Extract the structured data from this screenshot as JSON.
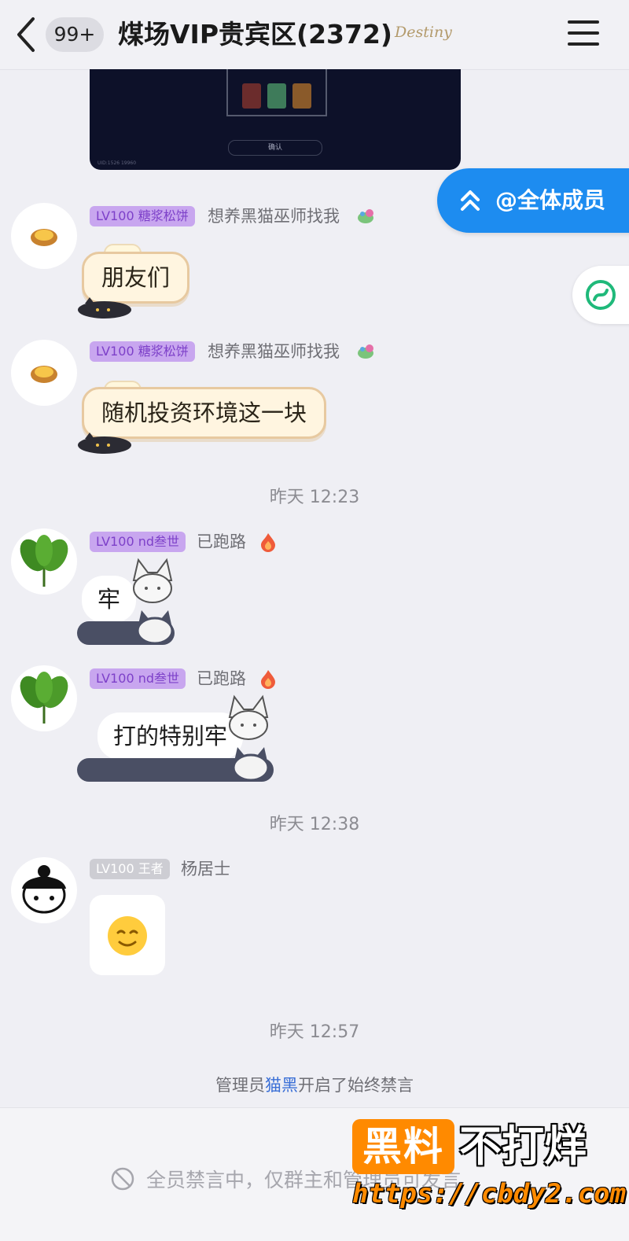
{
  "header": {
    "unread_count": "99+",
    "title": "煤场VIP贵宾区(2372)",
    "title_badge": "Destiny"
  },
  "top_image": {
    "confirm_label": "确认",
    "uid_text": "UID:1526 19960"
  },
  "floating": {
    "at_all_label": "@全体成员"
  },
  "messages": [
    {
      "level_tag": "LV100 糖浆松饼",
      "nickname": "想养黑猫巫师找我",
      "text": "朋友们"
    },
    {
      "level_tag": "LV100 糖浆松饼",
      "nickname": "想养黑猫巫师找我",
      "text": "随机投资环境这一块"
    },
    {
      "level_tag": "LV100 nd叁世",
      "nickname": "已跑路",
      "text": "牢"
    },
    {
      "level_tag": "LV100 nd叁世",
      "nickname": "已跑路",
      "text": "打的特别牢"
    },
    {
      "level_tag": "LV100 王者",
      "nickname": "杨居士",
      "emoji": "smile-face"
    }
  ],
  "timestamps": [
    "昨天 12:23",
    "昨天 12:38",
    "昨天 12:57"
  ],
  "system_notice": {
    "prefix": "管理员",
    "admin_name": "猫黑",
    "suffix": "开启了始终禁言"
  },
  "bottom": {
    "mute_text": "全员禁言中，仅群主和管理员可发言"
  },
  "watermark": {
    "box_text": "黑料",
    "text": "不打烊",
    "url": "https://cbdy2.com"
  },
  "colors": {
    "accent_blue": "#1d8cf0",
    "level_purple": "#c8a6ef",
    "watermark_orange": "#ff8a00"
  }
}
